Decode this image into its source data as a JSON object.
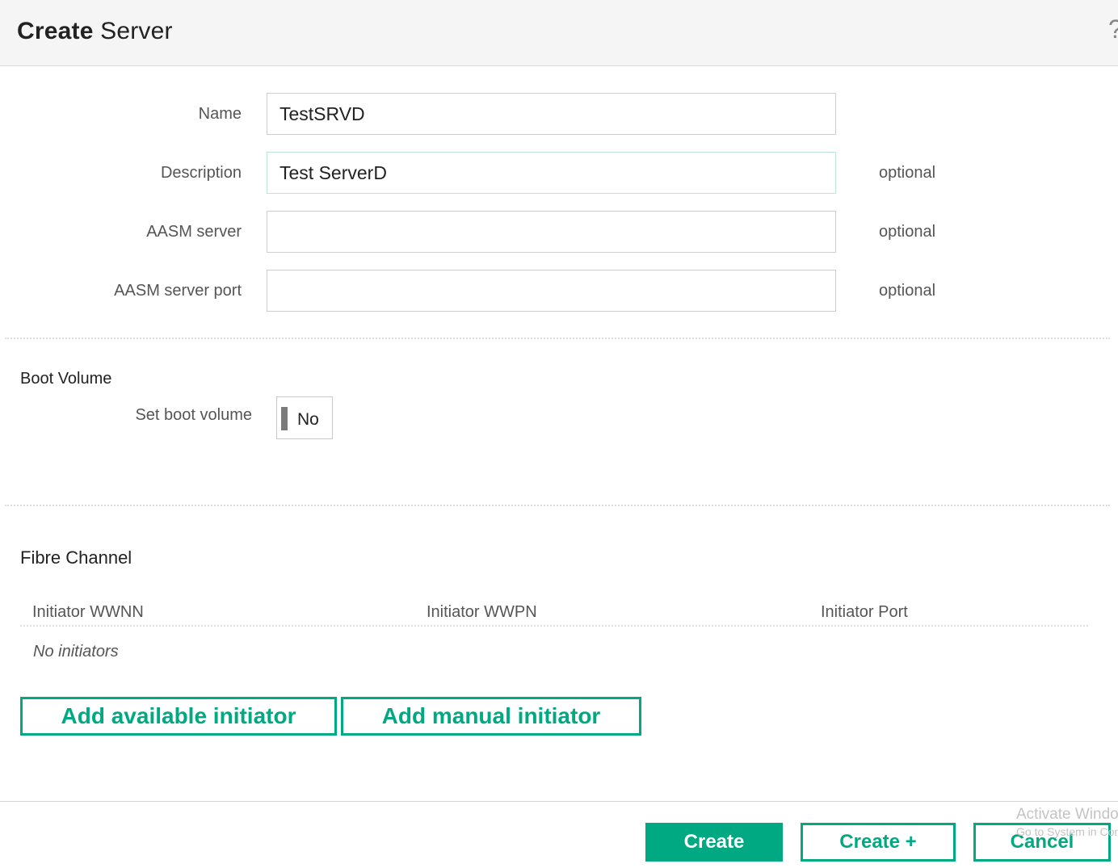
{
  "dialog": {
    "title_bold": "Create",
    "title_rest": " Server",
    "help_icon": "question-mark-icon"
  },
  "form": {
    "name_label": "Name",
    "name_value": "TestSRVD",
    "description_label": "Description",
    "description_value": "Test ServerD",
    "description_hint": "optional",
    "aasm_server_label": "AASM server",
    "aasm_server_value": "",
    "aasm_server_hint": "optional",
    "aasm_port_label": "AASM server port",
    "aasm_port_value": "",
    "aasm_port_hint": "optional"
  },
  "boot_volume": {
    "section_title": "Boot Volume",
    "set_label": "Set boot volume",
    "toggle_value": "No"
  },
  "fibre_channel": {
    "section_title": "Fibre Channel",
    "columns": [
      "Initiator WWNN",
      "Initiator WWPN",
      "Initiator Port"
    ],
    "empty_text": "No initiators",
    "add_available_label": "Add available initiator",
    "add_manual_label": "Add manual initiator"
  },
  "footer": {
    "create_label": "Create",
    "create_plus_label": "Create +",
    "cancel_label": "Cancel"
  },
  "watermark": {
    "line1": "Activate Windows",
    "line2": "Go to System in Control Panel"
  },
  "colors": {
    "accent": "#01a982"
  }
}
